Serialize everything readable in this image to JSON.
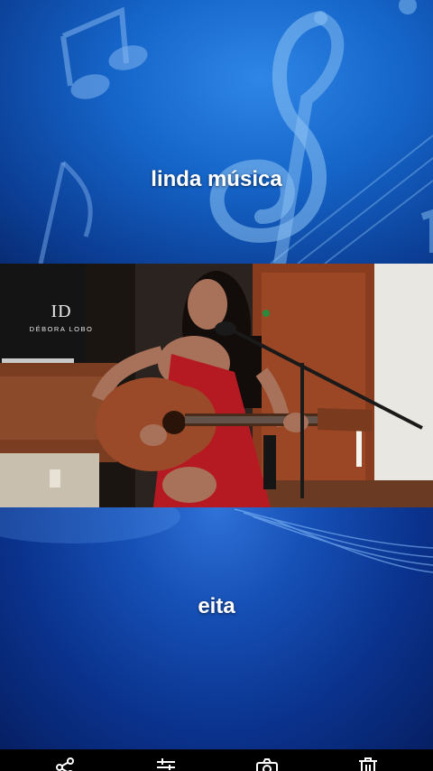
{
  "captions": {
    "top": "linda música",
    "bottom": "eita"
  },
  "video": {
    "watermark_logo": "ID",
    "watermark_name": "DÉBORA LOBO"
  },
  "toolbar": {
    "icons": [
      "share-icon",
      "adjust-icon",
      "camera-icon",
      "delete-icon"
    ]
  },
  "colors": {
    "top_bg": "#1565c9",
    "bottom_bg": "#0a338e",
    "dress": "#b51a22"
  }
}
